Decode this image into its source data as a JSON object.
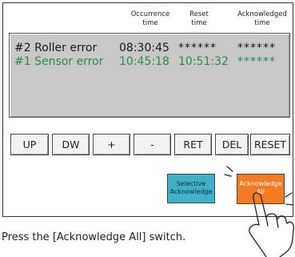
{
  "headers": {
    "occurrence": "Occurrence\ntime",
    "reset": "Reset\ntime",
    "acknowledged": "Acknowledged\ntime"
  },
  "alarms": [
    {
      "name": "#2 Roller error",
      "occurrence": "08:30:45",
      "reset": "******",
      "acknowledged": "******",
      "color": "#1a1a1a"
    },
    {
      "name": "#1 Sensor error",
      "occurrence": "10:45:18",
      "reset": "10:51:32",
      "acknowledged": "******",
      "color": "#2e8a4a"
    }
  ],
  "buttons": [
    "UP",
    "DW",
    "+",
    "-",
    "RET",
    "DEL",
    "RESET"
  ],
  "selective_acknowledge": "Selective\nAcknowledge",
  "acknowledge_all": "Acknowledge\nAll",
  "caption": "Press the [Acknowledge All] switch.",
  "colors": {
    "list_background": "#c8c8c8",
    "selective_acknowledge": "#3fb0c6",
    "acknowledge_all": "#f37b22"
  },
  "icons": [
    "pointing-hand-icon"
  ]
}
